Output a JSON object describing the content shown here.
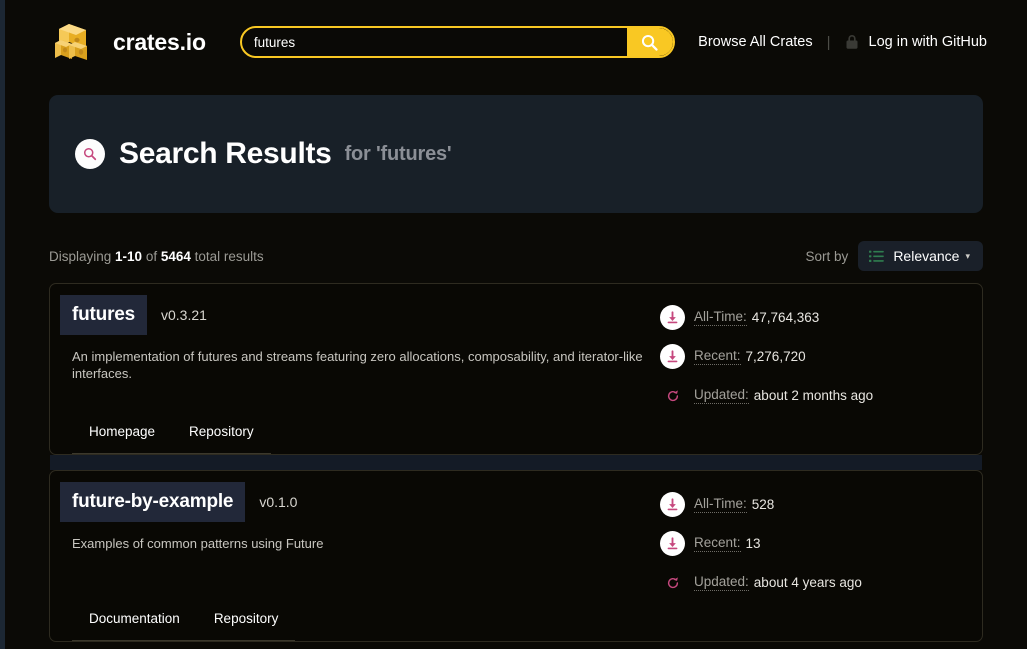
{
  "header": {
    "logo_text": "crates.io",
    "logo_icon": "crates-stack-logo",
    "search": {
      "value": "futures",
      "placeholder": "Search",
      "submit_icon": "search-icon"
    },
    "nav": {
      "browse_all_crates": "Browse All Crates",
      "divider": "|",
      "lock_icon": "lock-icon",
      "login": "Log in with GitHub"
    }
  },
  "hero": {
    "icon": "search-icon",
    "title": "Search Results",
    "subtitle": "for 'futures'"
  },
  "results_meta": {
    "displaying_prefix": "Displaying ",
    "range": "1-10",
    "of": " of ",
    "total": "5464",
    "suffix": " total results",
    "sort_label": "Sort by",
    "sort_icon": "list-icon",
    "sort_value": "Relevance",
    "sort_caret": "▾"
  },
  "results": [
    {
      "name": "futures",
      "version": "v0.3.21",
      "description": "An implementation of futures and streams featuring zero allocations, composability, and iterator-like interfaces.",
      "stats": {
        "all_time_label": "All-Time:",
        "all_time_value": "47,764,363",
        "recent_label": "Recent:",
        "recent_value": "7,276,720",
        "updated_label": "Updated:",
        "updated_value": "about 2 months ago"
      },
      "links": [
        "Homepage",
        "Repository"
      ]
    },
    {
      "name": "future-by-example",
      "version": "v0.1.0",
      "description": "Examples of common patterns using Future",
      "stats": {
        "all_time_label": "All-Time:",
        "all_time_value": "528",
        "recent_label": "Recent:",
        "recent_value": "13",
        "updated_label": "Updated:",
        "updated_value": "about 4 years ago"
      },
      "links": [
        "Documentation",
        "Repository"
      ]
    }
  ],
  "colors": {
    "background": "#0b0a06",
    "accent_gold": "#f9c823",
    "hero_bg": "#182028",
    "pink_icon": "#c6487e",
    "sort_icon_green": "#2f7d4f"
  }
}
